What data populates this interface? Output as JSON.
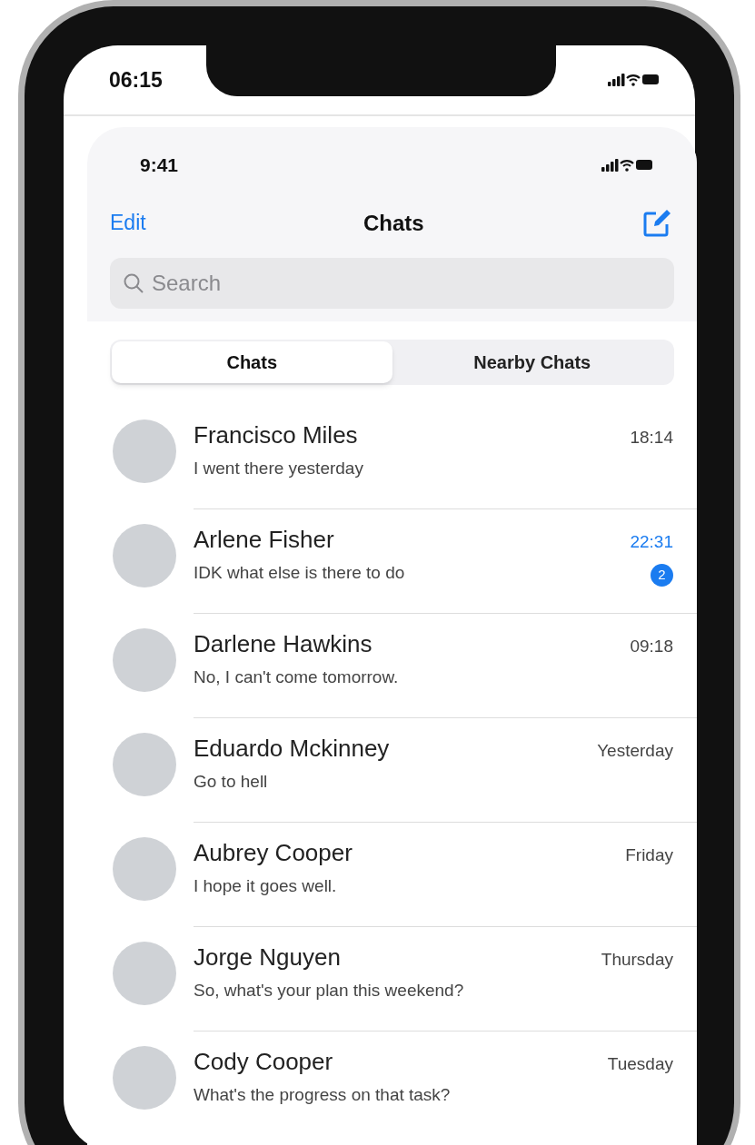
{
  "device_status": {
    "time": "06:15"
  },
  "status_bar": {
    "time": "9:41"
  },
  "nav": {
    "edit": "Edit",
    "title": "Chats"
  },
  "search": {
    "placeholder": "Search"
  },
  "segments": [
    {
      "label": "Chats",
      "selected": true
    },
    {
      "label": "Nearby Chats",
      "selected": false
    }
  ],
  "chats": [
    {
      "name": "Francisco Miles",
      "message": "I went there yesterday",
      "time": "18:14",
      "unread": false
    },
    {
      "name": "Arlene Fisher",
      "message": "IDK what else is there to do",
      "time": "22:31",
      "unread": true,
      "badge": "2"
    },
    {
      "name": "Darlene Hawkins",
      "message": "No, I can't come tomorrow.",
      "time": "09:18",
      "unread": false
    },
    {
      "name": "Eduardo Mckinney",
      "message": "Go to hell",
      "time": "Yesterday",
      "unread": false
    },
    {
      "name": "Aubrey Cooper",
      "message": "I hope it goes well.",
      "time": "Friday",
      "unread": false
    },
    {
      "name": "Jorge Nguyen",
      "message": "So, what's your plan this weekend?",
      "time": "Thursday",
      "unread": false
    },
    {
      "name": "Cody Cooper",
      "message": "What's the progress on that task?",
      "time": "Tuesday",
      "unread": false
    }
  ]
}
